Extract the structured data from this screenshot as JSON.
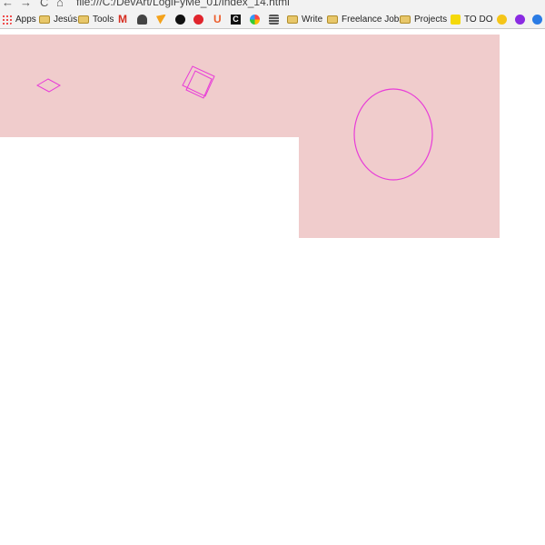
{
  "browser": {
    "back_glyph": "←",
    "forward_glyph": "→",
    "reload_glyph": "C",
    "home_glyph": "⌂",
    "address": "file:///C:/DevArt/LogiFyMe_01/index_14.html"
  },
  "bookmarks": {
    "apps": "Apps",
    "jesus": "Jesús",
    "tools": "Tools",
    "write": "Write",
    "freelance": "Freelance Jobs",
    "projects": "Projects",
    "todo": "TO DO",
    "gmail_glyph": "M",
    "u_glyph": "U",
    "c_glyph": "C"
  },
  "canvas": {
    "fill_color": "#f0cccc",
    "stroke_color": "#e83cd8"
  }
}
